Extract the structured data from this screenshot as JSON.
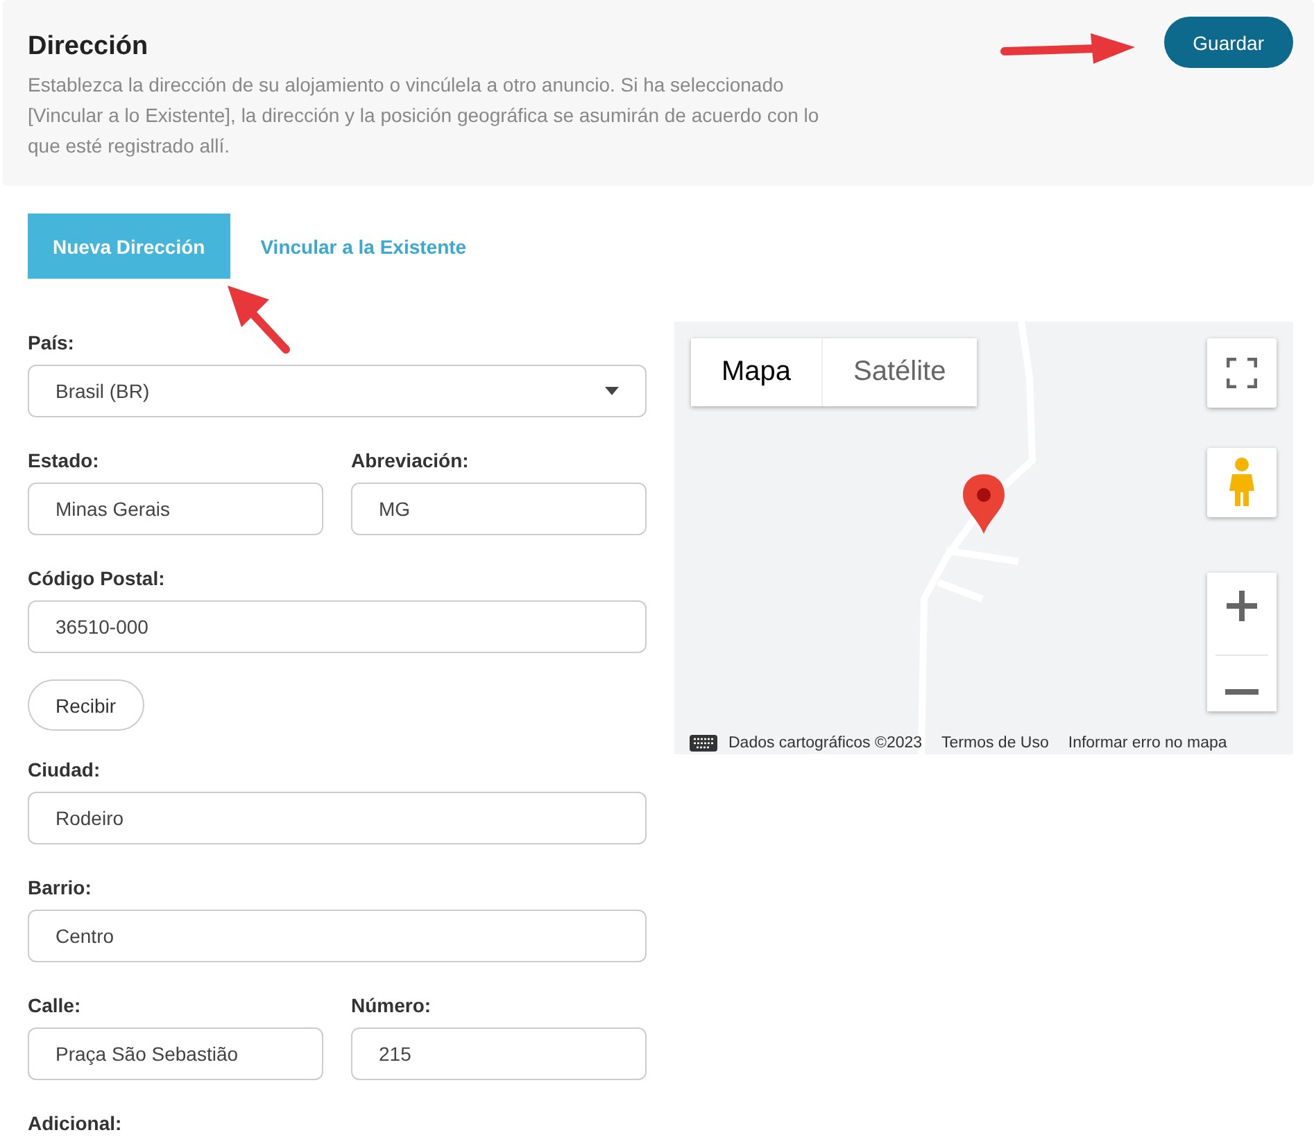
{
  "header": {
    "title": "Dirección",
    "description": "Establezca la dirección de su alojamiento o vincúlela a otro anuncio. Si ha seleccionado [Vincular a lo Existente], la dirección y la posición geográfica se asumirán de acuerdo con lo que esté registrado allí.",
    "save_button": "Guardar"
  },
  "tabs": [
    {
      "label": "Nueva Dirección",
      "selected": true
    },
    {
      "label": "Vincular a la Existente",
      "selected": false
    }
  ],
  "form": [
    {
      "kind": "fields",
      "fields": [
        {
          "label": "País:",
          "value": "Brasil (BR)",
          "kind": "select"
        }
      ]
    },
    {
      "kind": "fields",
      "fields": [
        {
          "label": "Estado:",
          "value": "Minas Gerais",
          "kind": "text"
        },
        {
          "label": "Abreviación:",
          "value": "MG",
          "kind": "text"
        }
      ]
    },
    {
      "kind": "fields",
      "fields": [
        {
          "label": "Código Postal:",
          "value": "36510-000",
          "kind": "text"
        }
      ]
    },
    {
      "kind": "button",
      "label": "Recibir"
    },
    {
      "kind": "fields",
      "fields": [
        {
          "label": "Ciudad:",
          "value": "Rodeiro",
          "kind": "text"
        }
      ]
    },
    {
      "kind": "fields",
      "fields": [
        {
          "label": "Barrio:",
          "value": "Centro",
          "kind": "text"
        }
      ]
    },
    {
      "kind": "fields",
      "fields": [
        {
          "label": "Calle:",
          "value": "Praça São Sebastião",
          "kind": "text"
        },
        {
          "label": "Número:",
          "value": "215",
          "kind": "text"
        }
      ]
    },
    {
      "kind": "label",
      "label": "Adicional:"
    }
  ],
  "map": {
    "map_types": [
      {
        "label": "Mapa",
        "selected": true
      },
      {
        "label": "Satélite",
        "selected": false
      }
    ],
    "attribution": [
      "Dados cartográficos ©2023",
      "Termos de Uso",
      "Informar erro no mapa"
    ]
  }
}
